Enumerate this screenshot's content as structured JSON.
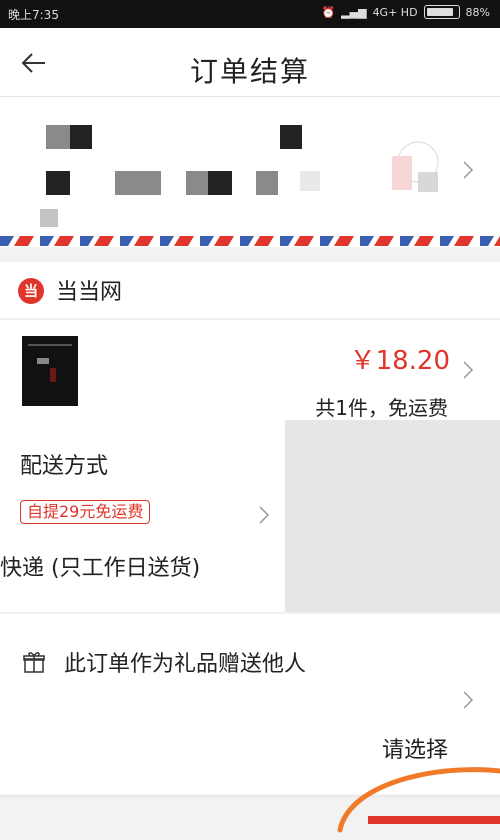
{
  "status_bar": {
    "time": "晚上7:35",
    "network": "4G+ HD",
    "battery": "88%"
  },
  "header": {
    "title": "订单结算",
    "back_icon": "arrow-left-icon"
  },
  "store": {
    "logo_text": "当",
    "name": "当当网"
  },
  "product": {
    "price": "￥18.20",
    "summary": "共1件，免运费"
  },
  "delivery": {
    "title": "配送方式",
    "promo_tag": "自提29元免运费",
    "method": "快递 (只工作日送货)"
  },
  "gift": {
    "label": "此订单作为礼品赠送他人",
    "action": "请选择"
  },
  "colors": {
    "accent_red": "#e0352b",
    "annotation_orange": "#f07a2a",
    "airmail_blue": "#3a5fb0"
  }
}
